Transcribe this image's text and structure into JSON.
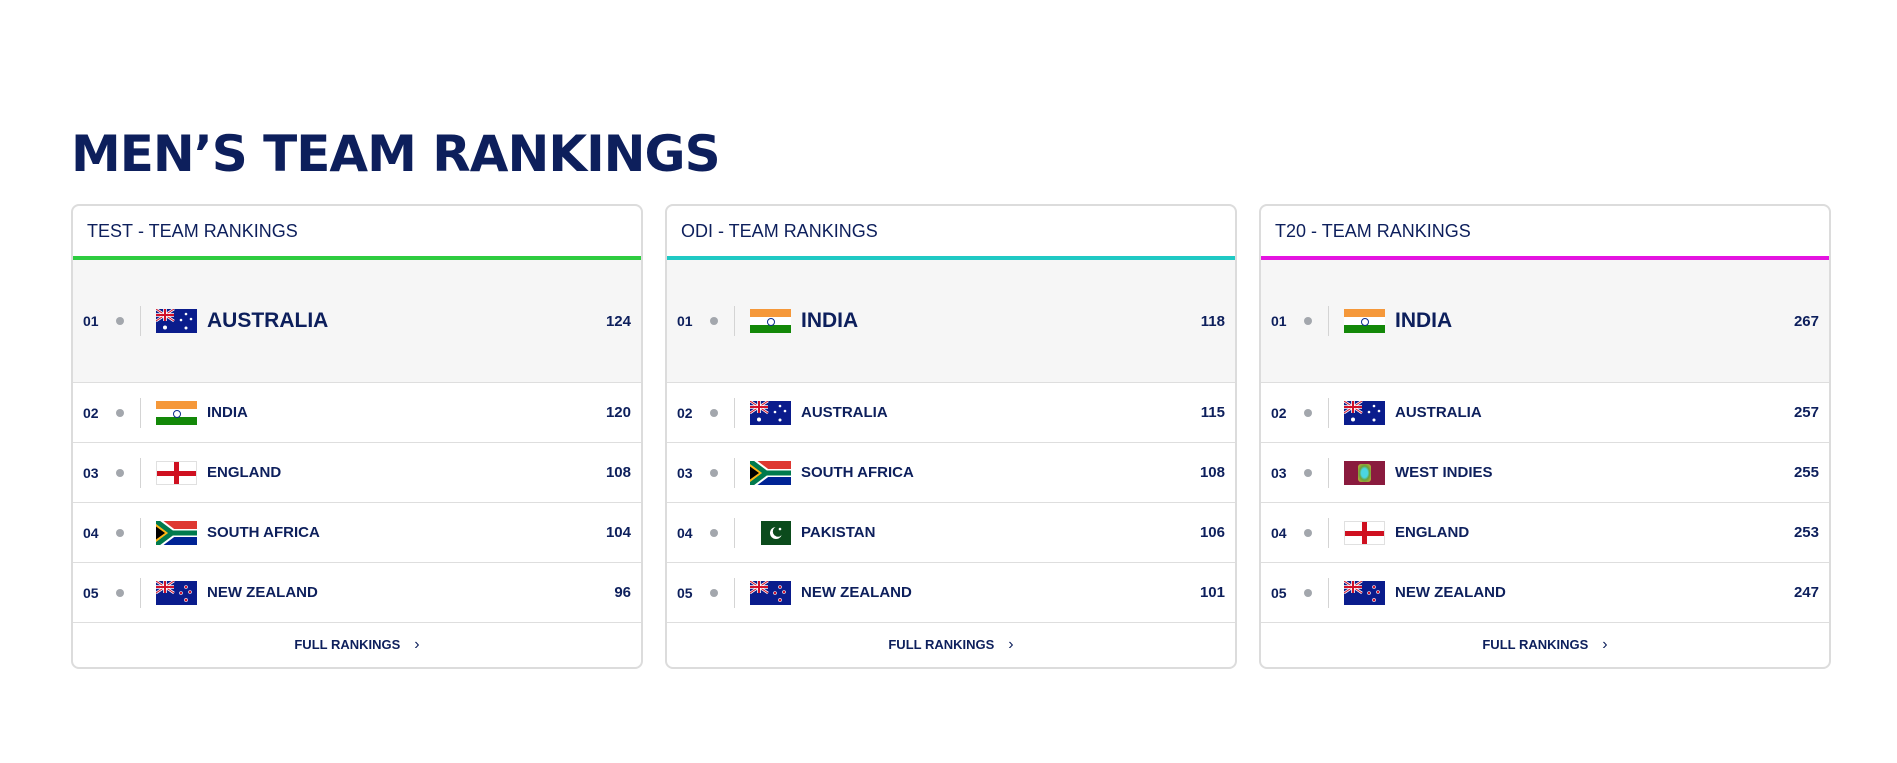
{
  "page": {
    "title": "MEN’S TEAM RANKINGS"
  },
  "cards": [
    {
      "format": "TEST",
      "suffix": "- TEAM RANKINGS",
      "accent": "#2ecc40",
      "footer": "FULL RANKINGS",
      "rows": [
        {
          "rank": "01",
          "team": "AUSTRALIA",
          "rating": "124",
          "flag": "australia-flag"
        },
        {
          "rank": "02",
          "team": "INDIA",
          "rating": "120",
          "flag": "india-flag"
        },
        {
          "rank": "03",
          "team": "ENGLAND",
          "rating": "108",
          "flag": "england-flag"
        },
        {
          "rank": "04",
          "team": "SOUTH AFRICA",
          "rating": "104",
          "flag": "south-africa-flag"
        },
        {
          "rank": "05",
          "team": "NEW ZEALAND",
          "rating": "96",
          "flag": "new-zealand-flag"
        }
      ]
    },
    {
      "format": "ODI",
      "suffix": "- TEAM RANKINGS",
      "accent": "#1fc9c4",
      "footer": "FULL RANKINGS",
      "rows": [
        {
          "rank": "01",
          "team": "INDIA",
          "rating": "118",
          "flag": "india-flag"
        },
        {
          "rank": "02",
          "team": "AUSTRALIA",
          "rating": "115",
          "flag": "australia-flag"
        },
        {
          "rank": "03",
          "team": "SOUTH AFRICA",
          "rating": "108",
          "flag": "south-africa-flag"
        },
        {
          "rank": "04",
          "team": "PAKISTAN",
          "rating": "106",
          "flag": "pakistan-flag"
        },
        {
          "rank": "05",
          "team": "NEW ZEALAND",
          "rating": "101",
          "flag": "new-zealand-flag"
        }
      ]
    },
    {
      "format": "T20",
      "suffix": "- TEAM RANKINGS",
      "accent": "#e414e0",
      "footer": "FULL RANKINGS",
      "rows": [
        {
          "rank": "01",
          "team": "INDIA",
          "rating": "267",
          "flag": "india-flag"
        },
        {
          "rank": "02",
          "team": "AUSTRALIA",
          "rating": "257",
          "flag": "australia-flag"
        },
        {
          "rank": "03",
          "team": "WEST INDIES",
          "rating": "255",
          "flag": "west-indies-flag"
        },
        {
          "rank": "04",
          "team": "ENGLAND",
          "rating": "253",
          "flag": "england-flag"
        },
        {
          "rank": "05",
          "team": "NEW ZEALAND",
          "rating": "247",
          "flag": "new-zealand-flag"
        }
      ]
    }
  ]
}
